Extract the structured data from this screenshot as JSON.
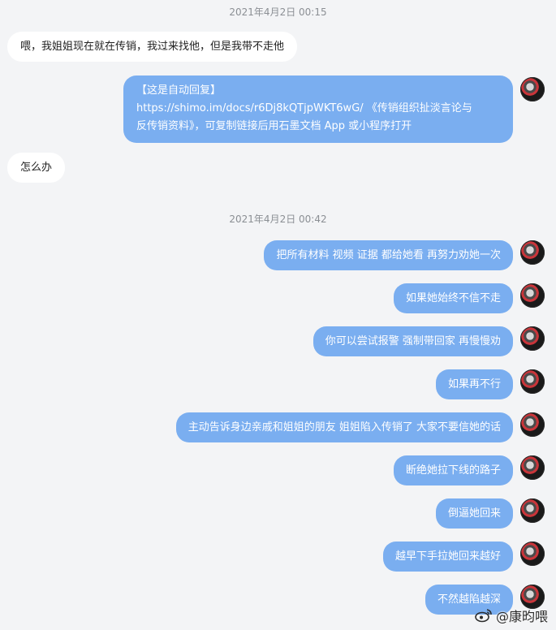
{
  "timestamps": [
    "2021年4月2日 00:15",
    "2021年4月2日 00:42"
  ],
  "incoming": [
    "喂，我姐姐现在就在传销，我过来找他，但是我带不走他",
    "怎么办"
  ],
  "auto_reply": {
    "line1": "【这是自动回复】",
    "line2": "https://shimo.im/docs/r6Dj8kQTjpWKT6wG/ 《传销组织扯淡言论与",
    "line3": "反传销资料》，可复制链接后用石墨文档 App 或小程序打开"
  },
  "outgoing": [
    "把所有材料 视频 证据 都给她看 再努力劝她一次",
    "如果她始终不信不走",
    "你可以尝试报警 强制带回家 再慢慢劝",
    "如果再不行",
    "主动告诉身边亲戚和姐姐的朋友 姐姐陷入传销了 大家不要信她的话",
    "断绝她拉下线的路子",
    "倒逼她回来",
    "越早下手拉她回来越好",
    "不然越陷越深"
  ],
  "avatar_icon": "user-avatar-icon",
  "watermark": {
    "icon": "weibo-icon",
    "text": "@康昀喂"
  },
  "colors": {
    "background": "#f3f4f6",
    "outgoing_bubble": "#7aaef0",
    "incoming_bubble": "#ffffff",
    "timestamp": "#8b8f94"
  }
}
